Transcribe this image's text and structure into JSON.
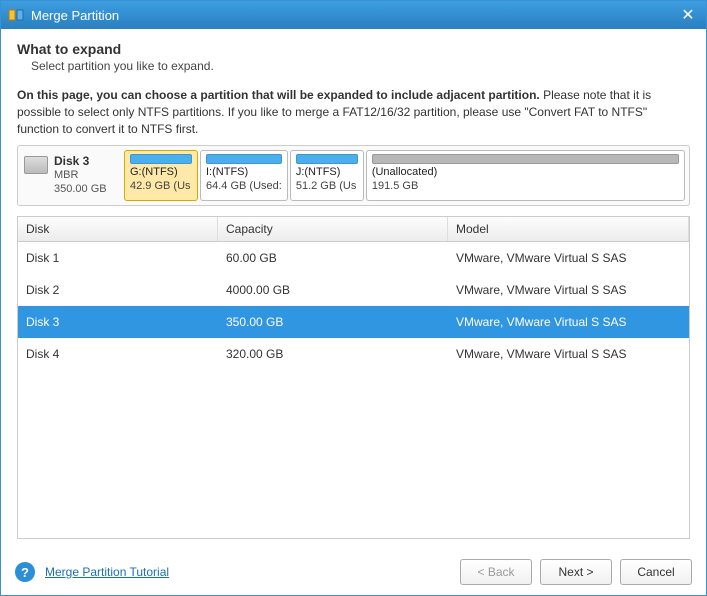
{
  "window": {
    "title": "Merge Partition"
  },
  "header": {
    "heading": "What to expand",
    "subheading": "Select partition you like to expand."
  },
  "instruction": {
    "bold": "On this page, you can choose a partition that will be expanded to include adjacent partition.",
    "rest": " Please note that it is possible to select only NTFS partitions. If you like to merge a FAT12/16/32 partition, please use \"Convert FAT to NTFS\" function to convert it to NTFS first."
  },
  "visual": {
    "disk": {
      "name": "Disk 3",
      "scheme": "MBR",
      "size": "350.00 GB"
    },
    "partitions": [
      {
        "label": "G:(NTFS)",
        "size": "42.9 GB (Us",
        "selected": true,
        "unallocated": false
      },
      {
        "label": "I:(NTFS)",
        "size": "64.4 GB (Used:",
        "selected": false,
        "unallocated": false
      },
      {
        "label": "J:(NTFS)",
        "size": "51.2 GB (Us",
        "selected": false,
        "unallocated": false
      },
      {
        "label": "(Unallocated)",
        "size": "191.5 GB",
        "selected": false,
        "unallocated": true
      }
    ]
  },
  "table": {
    "headers": {
      "disk": "Disk",
      "capacity": "Capacity",
      "model": "Model"
    },
    "rows": [
      {
        "disk": "Disk 1",
        "capacity": "60.00 GB",
        "model": "VMware, VMware Virtual S SAS",
        "selected": false
      },
      {
        "disk": "Disk 2",
        "capacity": "4000.00 GB",
        "model": "VMware, VMware Virtual S SAS",
        "selected": false
      },
      {
        "disk": "Disk 3",
        "capacity": "350.00 GB",
        "model": "VMware, VMware Virtual S SAS",
        "selected": true
      },
      {
        "disk": "Disk 4",
        "capacity": "320.00 GB",
        "model": "VMware, VMware Virtual S SAS",
        "selected": false
      }
    ]
  },
  "footer": {
    "tutorial": "Merge Partition Tutorial",
    "back": "< Back",
    "next": "Next >",
    "cancel": "Cancel"
  }
}
